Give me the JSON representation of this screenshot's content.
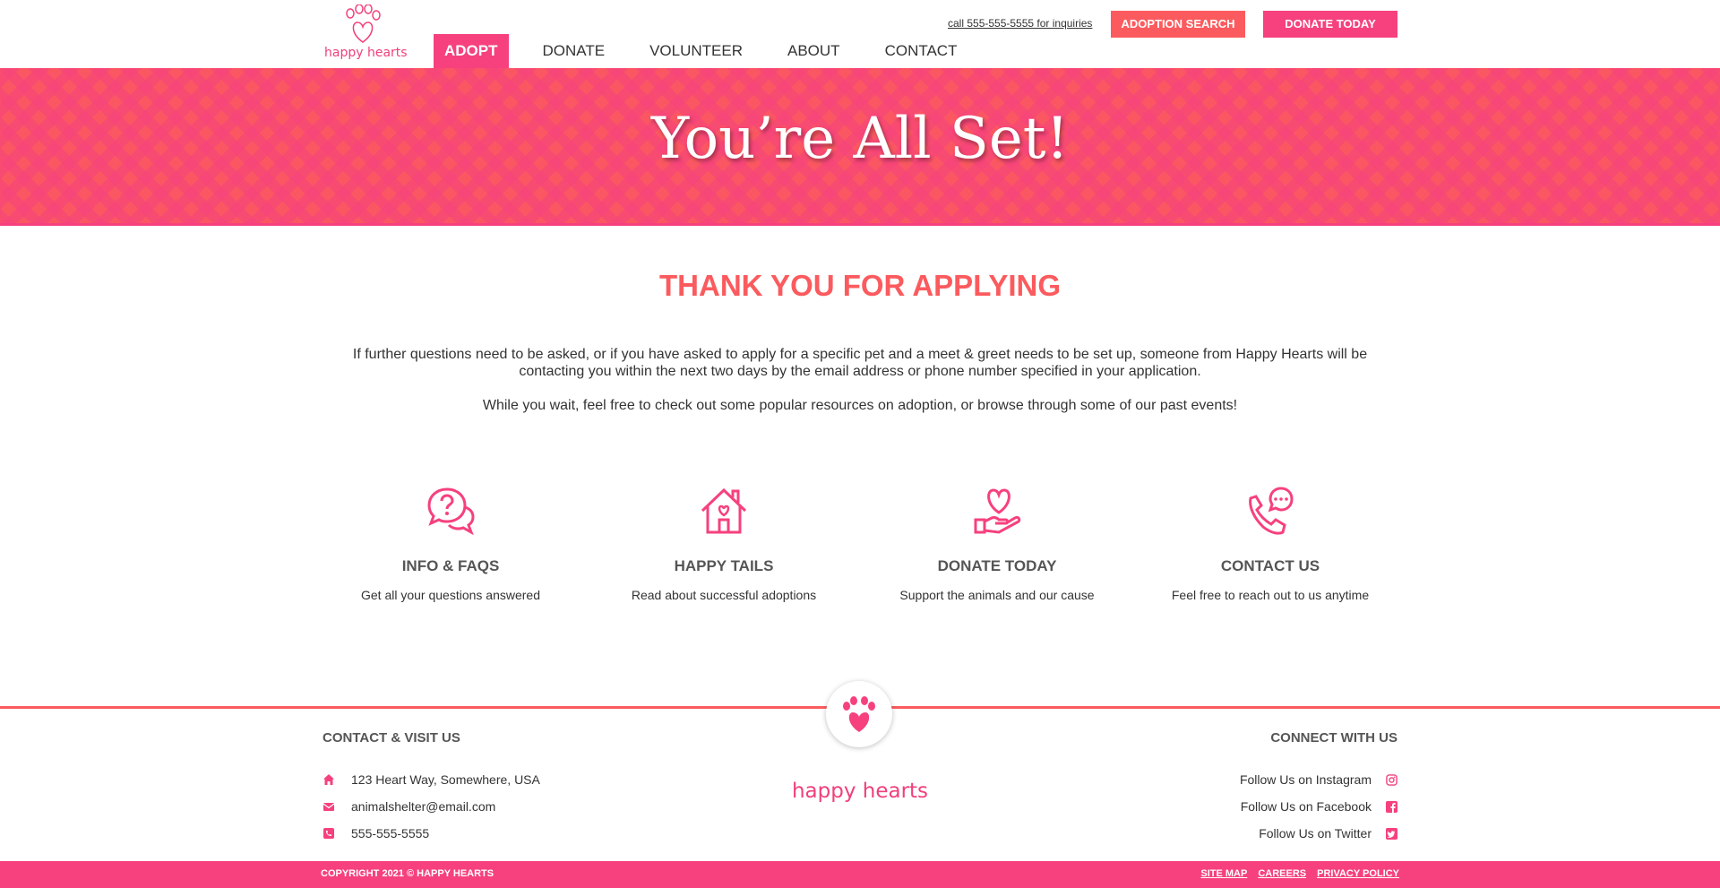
{
  "header": {
    "logo_text": "happy hearts",
    "phone_link": "call 555-555-5555 for inquiries",
    "adoption_search_label": "ADOPTION SEARCH",
    "donate_today_label": "DONATE TODAY",
    "nav": [
      {
        "label": "ADOPT",
        "active": true
      },
      {
        "label": "DONATE",
        "active": false
      },
      {
        "label": "VOLUNTEER",
        "active": false
      },
      {
        "label": "ABOUT",
        "active": false
      },
      {
        "label": "CONTACT",
        "active": false
      }
    ]
  },
  "hero": {
    "title": "You’re All Set!"
  },
  "main": {
    "title": "THANK YOU FOR APPLYING",
    "paragraph1": "If further questions need to be asked, or if you have asked to apply for a specific pet and a meet & greet needs to be set up, someone from Happy Hearts will be contacting you within the next two days by the email address or phone number specified in your application.",
    "paragraph2": "While you wait, feel free to check out some popular resources on adoption, or browse through some of our past events!",
    "features": [
      {
        "icon": "question-chat-icon",
        "title": "INFO & FAQS",
        "desc": "Get all your questions answered"
      },
      {
        "icon": "house-heart-icon",
        "title": "HAPPY TAILS",
        "desc": "Read about successful adoptions"
      },
      {
        "icon": "hand-heart-icon",
        "title": "DONATE TODAY",
        "desc": "Support the animals and our cause"
      },
      {
        "icon": "phone-chat-icon",
        "title": "CONTACT US",
        "desc": "Feel free to reach out to us anytime"
      }
    ]
  },
  "footer": {
    "contact_heading": "CONTACT & VISIT US",
    "connect_heading": "CONNECT WITH US",
    "logo_text": "happy hearts",
    "contact": [
      {
        "icon": "home-icon",
        "text": "123 Heart Way, Somewhere, USA"
      },
      {
        "icon": "envelope-icon",
        "text": "animalshelter@email.com"
      },
      {
        "icon": "phone-icon",
        "text": "555-555-5555"
      }
    ],
    "social": [
      {
        "icon": "instagram-icon",
        "text": "Follow Us on Instagram"
      },
      {
        "icon": "facebook-icon",
        "text": "Follow Us on Facebook"
      },
      {
        "icon": "twitter-icon",
        "text": "Follow Us on Twitter"
      }
    ],
    "copyright": "COPYRIGHT 2021 © HAPPY HEARTS",
    "links": [
      "SITE MAP",
      "CAREERS",
      "PRIVACY POLICY"
    ]
  },
  "colors": {
    "pink": "#f6417e",
    "coral": "#fb5b5e",
    "text": "#333333"
  }
}
